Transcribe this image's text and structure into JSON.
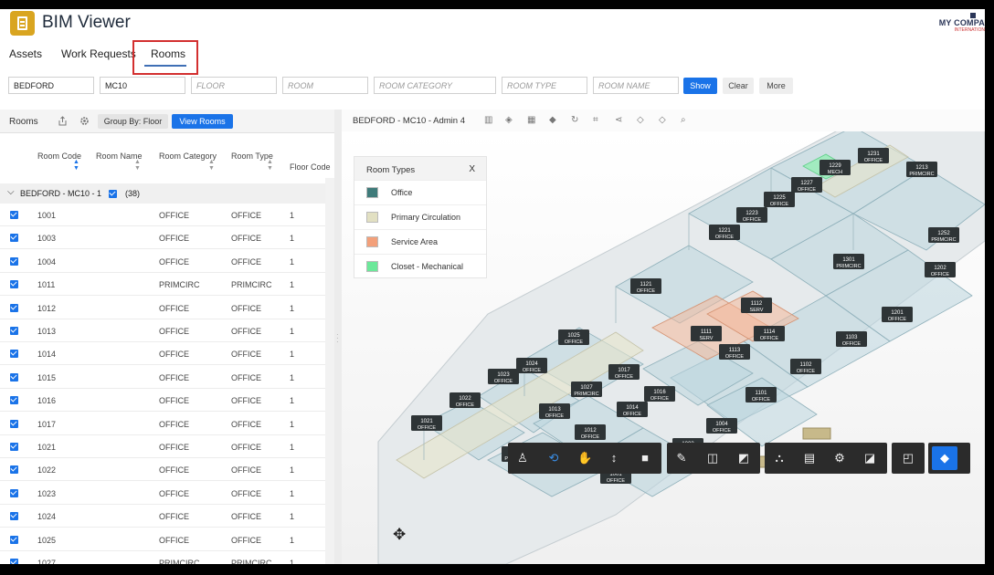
{
  "app": {
    "title": "BIM Viewer",
    "company_name": "MY COMPA",
    "company_sub": "INTERNATION"
  },
  "tabs": [
    {
      "label": "Assets"
    },
    {
      "label": "Work Requests"
    },
    {
      "label": "Rooms",
      "active": true
    }
  ],
  "filters": {
    "site": "BEDFORD",
    "building": "MC10",
    "floor_placeholder": "FLOOR",
    "room_placeholder": "ROOM",
    "category_placeholder": "ROOM CATEGORY",
    "type_placeholder": "ROOM TYPE",
    "name_placeholder": "ROOM NAME",
    "show": "Show",
    "clear": "Clear",
    "more": "More"
  },
  "rooms_panel": {
    "title": "Rooms",
    "group_by": "Group By: Floor",
    "view_rooms": "View Rooms",
    "columns": [
      "Room Code",
      "Room Name",
      "Room Category",
      "Room Type",
      "Floor Code"
    ],
    "group": {
      "label": "BEDFORD - MC10 - 1",
      "count": "(38)"
    },
    "rows": [
      {
        "code": "1001",
        "name": "",
        "category": "OFFICE",
        "type": "OFFICE",
        "floor": "1"
      },
      {
        "code": "1003",
        "name": "",
        "category": "OFFICE",
        "type": "OFFICE",
        "floor": "1"
      },
      {
        "code": "1004",
        "name": "",
        "category": "OFFICE",
        "type": "OFFICE",
        "floor": "1"
      },
      {
        "code": "1011",
        "name": "",
        "category": "PRIMCIRC",
        "type": "PRIMCIRC",
        "floor": "1"
      },
      {
        "code": "1012",
        "name": "",
        "category": "OFFICE",
        "type": "OFFICE",
        "floor": "1"
      },
      {
        "code": "1013",
        "name": "",
        "category": "OFFICE",
        "type": "OFFICE",
        "floor": "1"
      },
      {
        "code": "1014",
        "name": "",
        "category": "OFFICE",
        "type": "OFFICE",
        "floor": "1"
      },
      {
        "code": "1015",
        "name": "",
        "category": "OFFICE",
        "type": "OFFICE",
        "floor": "1"
      },
      {
        "code": "1016",
        "name": "",
        "category": "OFFICE",
        "type": "OFFICE",
        "floor": "1"
      },
      {
        "code": "1017",
        "name": "",
        "category": "OFFICE",
        "type": "OFFICE",
        "floor": "1"
      },
      {
        "code": "1021",
        "name": "",
        "category": "OFFICE",
        "type": "OFFICE",
        "floor": "1"
      },
      {
        "code": "1022",
        "name": "",
        "category": "OFFICE",
        "type": "OFFICE",
        "floor": "1"
      },
      {
        "code": "1023",
        "name": "",
        "category": "OFFICE",
        "type": "OFFICE",
        "floor": "1"
      },
      {
        "code": "1024",
        "name": "",
        "category": "OFFICE",
        "type": "OFFICE",
        "floor": "1"
      },
      {
        "code": "1025",
        "name": "",
        "category": "OFFICE",
        "type": "OFFICE",
        "floor": "1"
      },
      {
        "code": "1027",
        "name": "",
        "category": "PRIMCIRC",
        "type": "PRIMCIRC",
        "floor": "1"
      }
    ]
  },
  "viewer": {
    "title": "BEDFORD - MC10 - Admin 4",
    "legend": {
      "title": "Room Types",
      "close": "X",
      "items": [
        {
          "label": "Office",
          "color": "#3f7b7a"
        },
        {
          "label": "Primary Circulation",
          "color": "#e2e0c2"
        },
        {
          "label": "Service Area",
          "color": "#f3a07a"
        },
        {
          "label": "Closet - Mechanical",
          "color": "#6ce89a"
        }
      ]
    },
    "room_tags": [
      {
        "code": "1231",
        "label": "OFFICE"
      },
      {
        "code": "1229",
        "label": "MECH"
      },
      {
        "code": "1213",
        "label": "PRIMCIRC"
      },
      {
        "code": "1227",
        "label": "OFFICE"
      },
      {
        "code": "1225",
        "label": "OFFICE"
      },
      {
        "code": "1223",
        "label": "OFFICE"
      },
      {
        "code": "1252",
        "label": "PRIMCIRC"
      },
      {
        "code": "1221",
        "label": "OFFICE"
      },
      {
        "code": "1301",
        "label": "PRIMCIRC"
      },
      {
        "code": "1202",
        "label": "OFFICE"
      },
      {
        "code": "1121",
        "label": "OFFICE"
      },
      {
        "code": "1112",
        "label": "SERV"
      },
      {
        "code": "1201",
        "label": "OFFICE"
      },
      {
        "code": "1111",
        "label": "SERV"
      },
      {
        "code": "1114",
        "label": "OFFICE"
      },
      {
        "code": "1103",
        "label": "OFFICE"
      },
      {
        "code": "1025",
        "label": "OFFICE"
      },
      {
        "code": "1113",
        "label": "OFFICE"
      },
      {
        "code": "1024",
        "label": "OFFICE"
      },
      {
        "code": "1102",
        "label": "OFFICE"
      },
      {
        "code": "1017",
        "label": "OFFICE"
      },
      {
        "code": "1023",
        "label": "OFFICE"
      },
      {
        "code": "1027",
        "label": "PRIMCIRC"
      },
      {
        "code": "1016",
        "label": "OFFICE"
      },
      {
        "code": "1101",
        "label": "OFFICE"
      },
      {
        "code": "1022",
        "label": "OFFICE"
      },
      {
        "code": "1014",
        "label": "OFFICE"
      },
      {
        "code": "1013",
        "label": "OFFICE"
      },
      {
        "code": "1004",
        "label": "OFFICE"
      },
      {
        "code": "1021",
        "label": "OFFICE"
      },
      {
        "code": "1012",
        "label": "OFFICE"
      },
      {
        "code": "1003",
        "label": "OFFICE"
      },
      {
        "code": "1011",
        "label": "PRIMCIRC"
      },
      {
        "code": "1001",
        "label": "OFFICE"
      }
    ]
  }
}
